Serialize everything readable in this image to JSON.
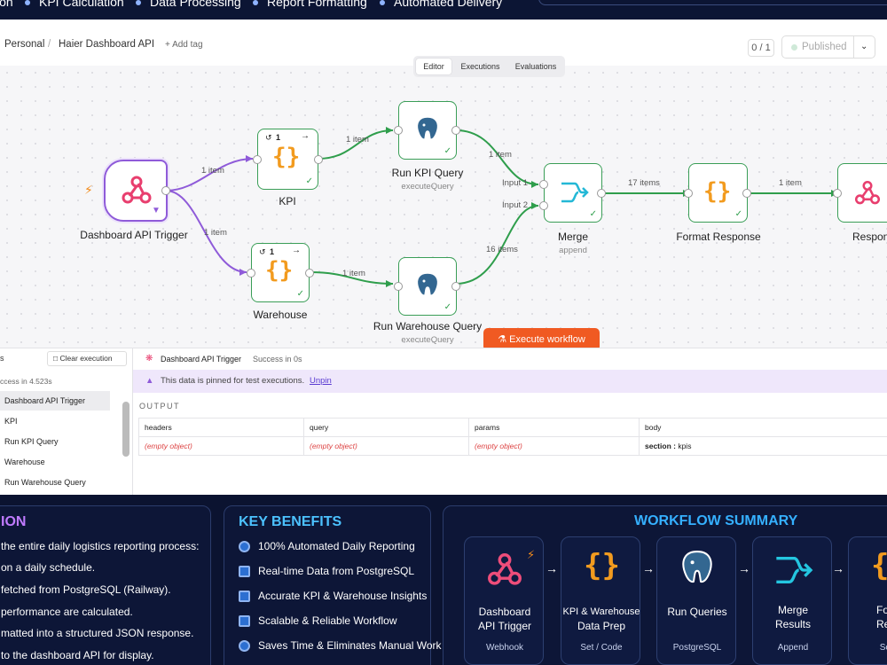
{
  "banner": {
    "items": [
      "ion",
      "KPI Calculation",
      "Data Processing",
      "Report Formatting",
      "Automated Delivery"
    ]
  },
  "header": {
    "breadcrumb_root": "Personal",
    "breadcrumb_sep": "/",
    "workflow_name": "Haier Dashboard API",
    "add_tag": "+ Add tag",
    "counter": "0 / 1",
    "published": "Published"
  },
  "tabs": [
    "Editor",
    "Executions",
    "Evaluations"
  ],
  "nodes": {
    "trigger": "Dashboard API Trigger",
    "kpi": "KPI",
    "warehouse": "Warehouse",
    "run_kpi": "Run KPI Query",
    "run_kpi_sub": "executeQuery",
    "run_wh": "Run Warehouse Query",
    "run_wh_sub": "executeQuery",
    "merge": "Merge",
    "merge_sub": "append",
    "format": "Format Response",
    "respond": "Respond",
    "kpi_badge": "1"
  },
  "edges": {
    "t_kpi": "1 item",
    "t_wh": "1 item",
    "kpi_run": "1 item",
    "wh_run": "1 item",
    "run_merge": "1 item",
    "runwh_merge": "16 items",
    "merge_input1": "Input 1",
    "merge_input2": "Input 2",
    "merge_fmt": "17 items",
    "fmt_resp": "1 item"
  },
  "execute_button": "Execute workflow",
  "left_panel": {
    "header": "s",
    "clear": "Clear execution",
    "success": "ccess in 4.523s",
    "items": [
      "Dashboard API Trigger",
      "KPI",
      "Run KPI Query",
      "Warehouse",
      "Run Warehouse Query"
    ]
  },
  "right_panel": {
    "node": "Dashboard API Trigger",
    "status": "Success in 0s",
    "pinned": "This data is pinned for test executions.",
    "unpin": "Unpin",
    "output": "OUTPUT",
    "columns": [
      "headers",
      "query",
      "params",
      "body"
    ],
    "row": [
      "(empty object)",
      "(empty object)",
      "(empty object)"
    ],
    "body_key": "section :",
    "body_val": "kpis"
  },
  "left_card": {
    "title": "ION",
    "lines": [
      "the entire daily logistics reporting process:",
      "on a daily schedule.",
      "fetched from PostgreSQL (Railway).",
      "performance are calculated.",
      "matted into a structured JSON response.",
      "to the dashboard API for display."
    ]
  },
  "benefits": {
    "title": "KEY BENEFITS",
    "items": [
      "100% Automated Daily Reporting",
      "Real-time Data from PostgreSQL",
      "Accurate KPI & Warehouse Insights",
      "Scalable & Reliable Workflow",
      "Saves Time & Eliminates Manual Work"
    ]
  },
  "summary": {
    "title": "WORKFLOW SUMMARY",
    "steps": [
      {
        "title1": "Dashboard",
        "title2": "API Trigger",
        "sub": "Webhook"
      },
      {
        "title1": "KPI & Warehouse",
        "title2": "Data Prep",
        "sub": "Set / Code"
      },
      {
        "title1": "Run Queries",
        "title2": "",
        "sub": "PostgreSQL"
      },
      {
        "title1": "Merge",
        "title2": "Results",
        "sub": "Append"
      },
      {
        "title1": "Form",
        "title2": "Resp",
        "sub": "Set /"
      }
    ]
  },
  "colors": {
    "accent_orange": "#f05a22",
    "node_green": "#3a9e57",
    "trigger_purple": "#8f5bd9",
    "postgres_blue": "#336791",
    "banner_bg": "#0c1534",
    "summary_title": "#35b0ff",
    "benefits_title": "#4cc2ff",
    "left_title": "#c07bff"
  }
}
